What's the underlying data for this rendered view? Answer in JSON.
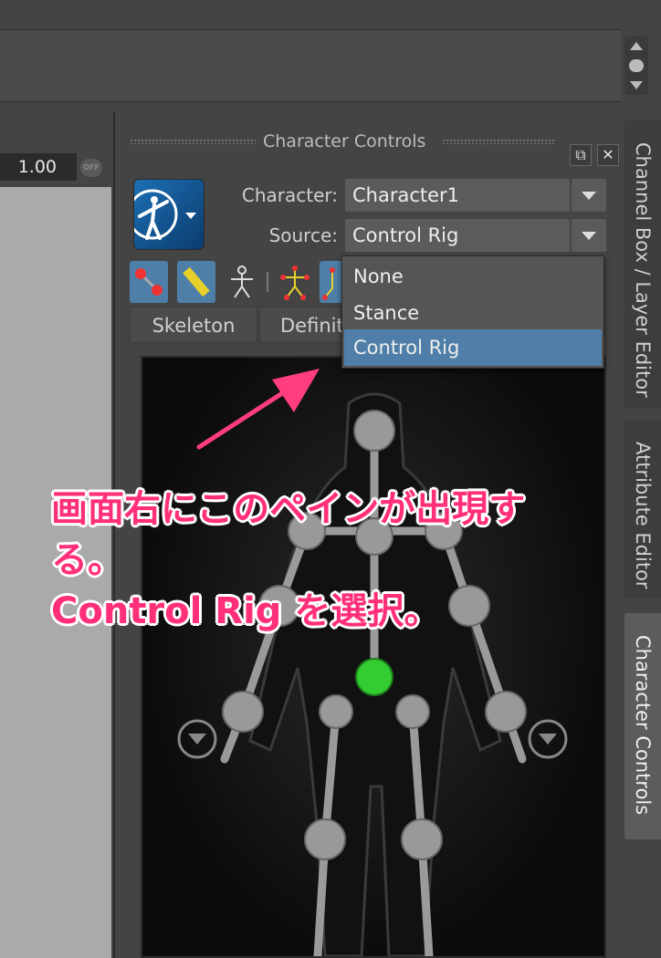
{
  "value_field": "1.00",
  "off_label": "OFF",
  "panel": {
    "title": "Character Controls",
    "float_glyph": "⧉",
    "close_glyph": "✕"
  },
  "character_label": "Character:",
  "character_value": "Character1",
  "source_label": "Source:",
  "source_value": "Control Rig",
  "tabs": [
    "Skeleton",
    "Definiti"
  ],
  "dropdown_options": [
    {
      "label": "None",
      "selected": false
    },
    {
      "label": "Stance",
      "selected": false
    },
    {
      "label": "Control Rig",
      "selected": true
    }
  ],
  "side_tabs": [
    {
      "label": "Channel Box / Layer Editor",
      "active": false
    },
    {
      "label": "Attribute Editor",
      "active": false
    },
    {
      "label": "Character Controls",
      "active": true
    }
  ],
  "annotation": {
    "line1": "画面右にこのペインが出現す",
    "line2": "る。",
    "line3": "Control Rig を選択。"
  },
  "colors": {
    "accent": "#4f7fa8",
    "annotation": "#ff2f7a",
    "effector_active": "#33cc33"
  }
}
